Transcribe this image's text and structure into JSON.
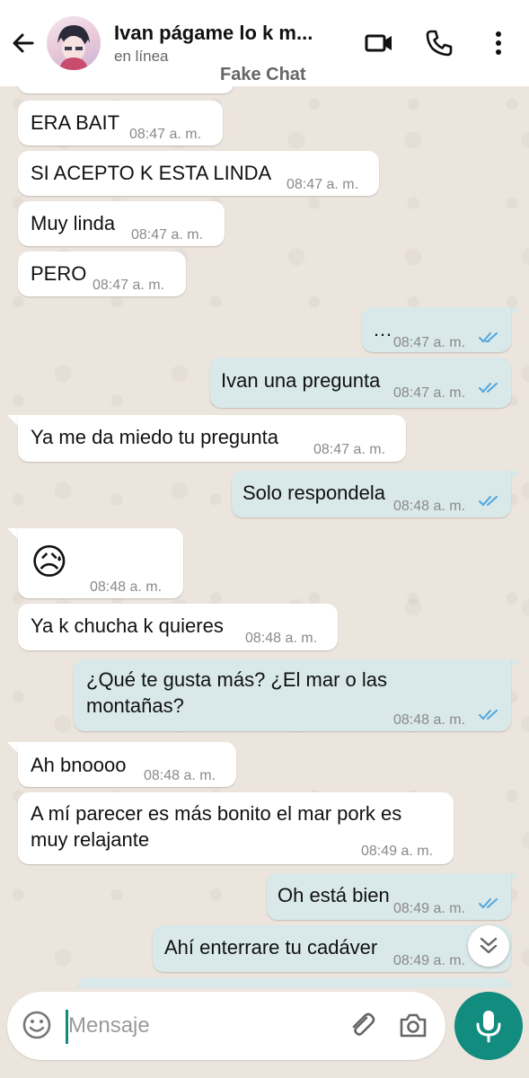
{
  "header": {
    "contact_name": "Ivan págame lo k m...",
    "status": "en línea",
    "watermark": "Fake Chat"
  },
  "messages": [
    {
      "dir": "in",
      "text": "ERA BAIT",
      "time": "08:47 a. m."
    },
    {
      "dir": "in",
      "text": "SI ACEPTO K ESTA LINDA",
      "time": "08:47 a. m."
    },
    {
      "dir": "in",
      "text": "Muy linda",
      "time": "08:47 a. m."
    },
    {
      "dir": "in",
      "text": "PERO",
      "time": "08:47 a. m."
    },
    {
      "dir": "out",
      "text": "…",
      "time": "08:47 a. m.",
      "status": "read"
    },
    {
      "dir": "out",
      "text": "Ivan una pregunta",
      "time": "08:47 a. m.",
      "status": "read"
    },
    {
      "dir": "in",
      "text": "Ya me da miedo tu pregunta",
      "time": "08:47 a. m."
    },
    {
      "dir": "out",
      "text": "Solo respondela",
      "time": "08:48 a. m.",
      "status": "read"
    },
    {
      "dir": "in",
      "text": "😥",
      "time": "08:48 a. m."
    },
    {
      "dir": "in",
      "text": "Ya k chucha k quieres",
      "time": "08:48 a. m."
    },
    {
      "dir": "out",
      "text_line1": "¿Qué te gusta más? ¿El mar o las",
      "text_line2": "montañas?",
      "time": "08:48 a. m.",
      "status": "read"
    },
    {
      "dir": "in",
      "text": "Ah bnoooo",
      "time": "08:48 a. m."
    },
    {
      "dir": "in",
      "text_line1": "A mí parecer es más bonito el mar pork es",
      "text_line2": "muy relajante",
      "time": "08:49 a. m."
    },
    {
      "dir": "out",
      "text": "Oh está bien",
      "time": "08:49 a. m.",
      "status": "read"
    },
    {
      "dir": "out",
      "text": "Ahí enterrare tu cadáver",
      "time": "08:49 a. m.",
      "status": "read"
    }
  ],
  "composer": {
    "placeholder": "Mensaje"
  },
  "icons": {
    "back": "arrow-back-icon",
    "video": "video-call-icon",
    "call": "phone-icon",
    "more": "more-vertical-icon",
    "emoji": "emoji-icon",
    "attach": "paperclip-icon",
    "camera": "camera-icon",
    "mic": "microphone-icon",
    "scroll": "double-chevron-down-icon"
  },
  "colors": {
    "accent": "#128c7e",
    "outgoing_bubble": "#d9e8e8",
    "incoming_bubble": "#ffffff",
    "read_ticks": "#4fa6e0",
    "chat_background": "#ece5dd"
  }
}
